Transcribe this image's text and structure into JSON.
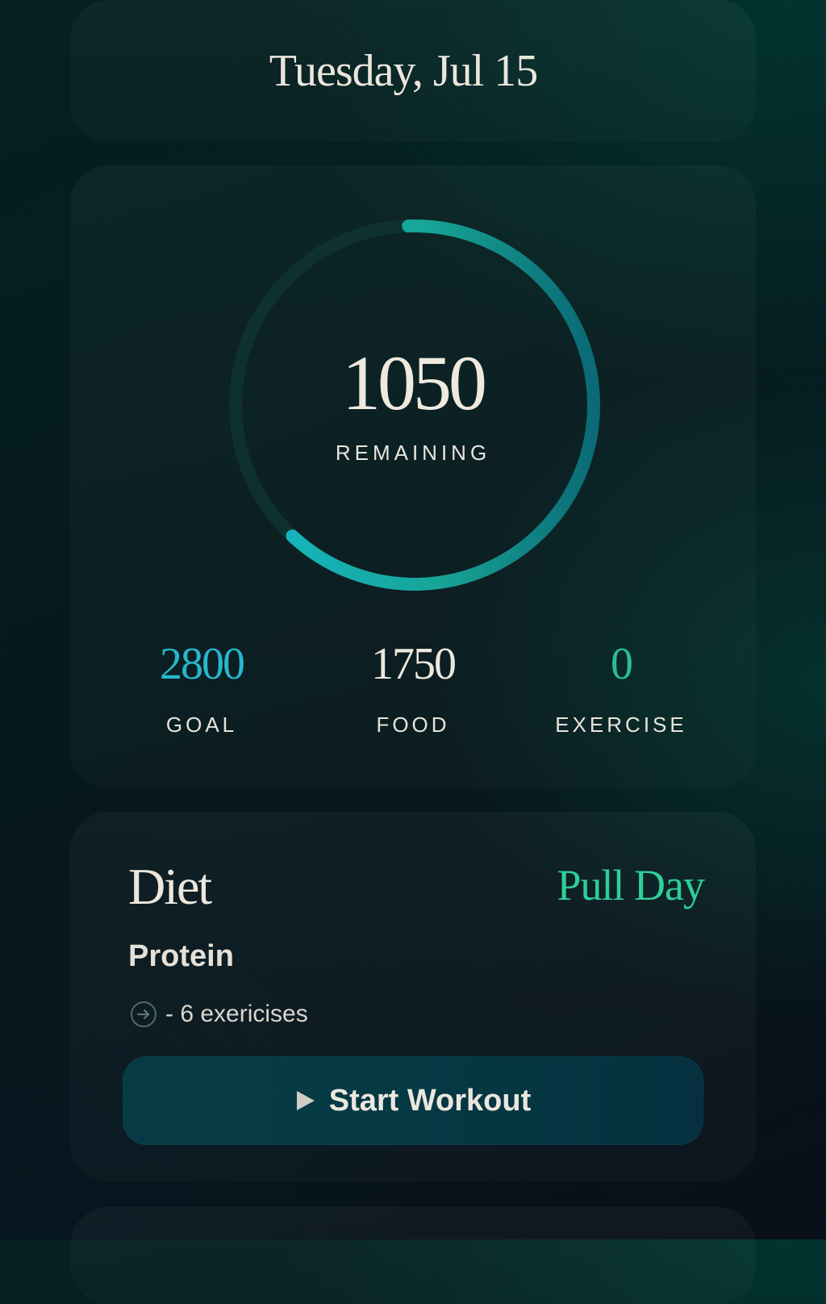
{
  "header": {
    "date": "Tuesday, Jul 15"
  },
  "calories": {
    "remaining_value": "1050",
    "remaining_label": "REMAINING",
    "progress_fraction": 0.625,
    "stats": [
      {
        "value": "2800",
        "label": "GOAL",
        "color": "#27b7c9"
      },
      {
        "value": "1750",
        "label": "FOOD",
        "color": "#ede8dd"
      },
      {
        "value": "0",
        "label": "EXERCISE",
        "color": "#2bbf8f"
      }
    ]
  },
  "diet": {
    "title": "Diet",
    "plan": "Pull Day",
    "plan_color": "#2fcf98",
    "subtitle": "Protein",
    "exercises_text": "- 6 exericises",
    "start_button_label": "Start Workout",
    "icons": {
      "exercises": "arrow-circle-icon",
      "start": "play-icon"
    }
  },
  "colors": {
    "ring_start": "#14b8c8",
    "ring_end": "#0a6e78",
    "ring_track": "#103834"
  }
}
